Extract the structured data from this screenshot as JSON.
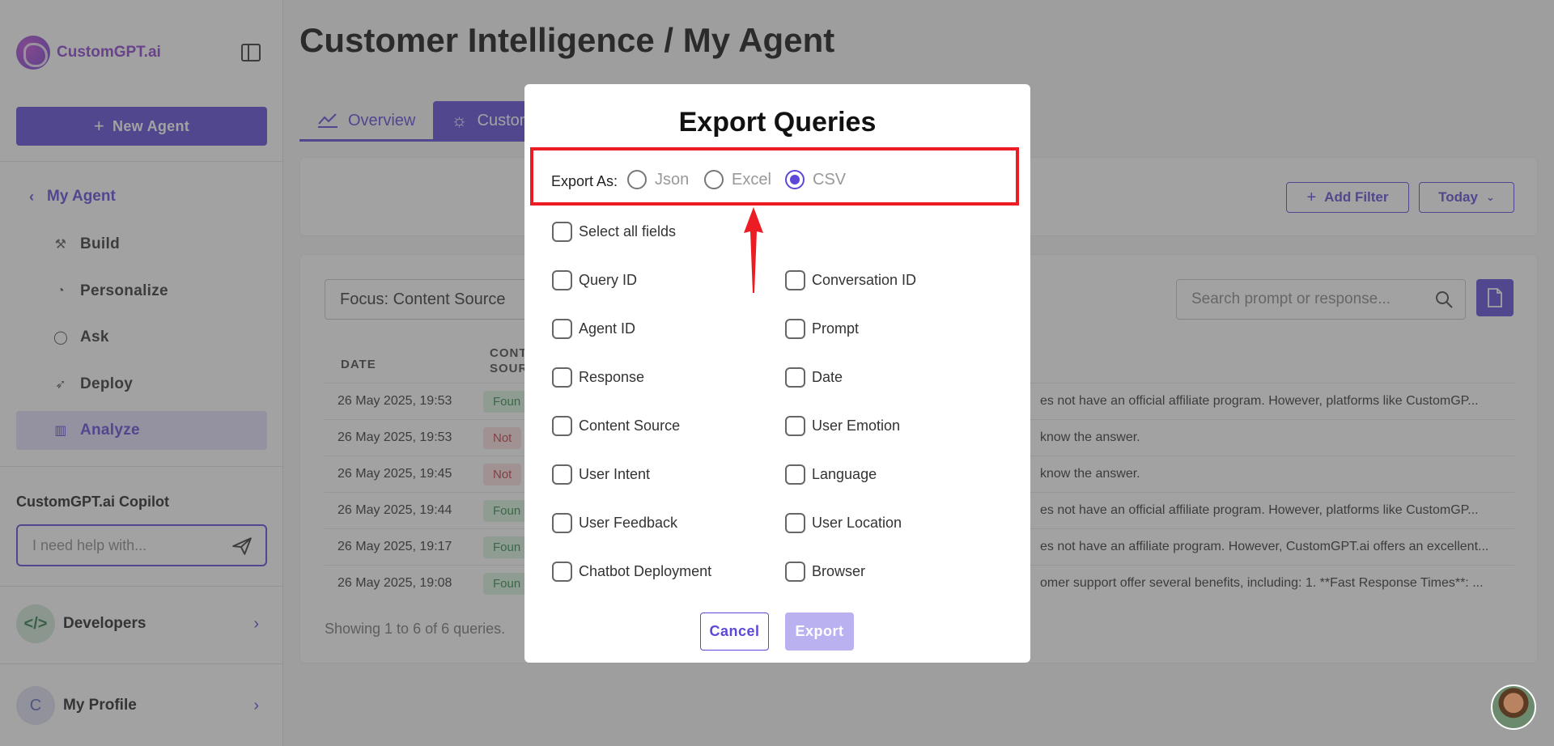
{
  "sidebar": {
    "logo_text": "CustomGPT.ai",
    "new_agent_label": "New Agent",
    "back_label": "My Agent",
    "items": [
      {
        "label": "Build",
        "icon": "build-icon"
      },
      {
        "label": "Personalize",
        "icon": "palette-icon"
      },
      {
        "label": "Ask",
        "icon": "chat-icon"
      },
      {
        "label": "Deploy",
        "icon": "rocket-icon"
      },
      {
        "label": "Analyze",
        "icon": "chart-icon",
        "active": true
      }
    ],
    "copilot_title": "CustomGPT.ai Copilot",
    "copilot_placeholder": "I need help with...",
    "developers_label": "Developers",
    "profile_label": "My Profile",
    "profile_initial": "C"
  },
  "header": {
    "title": "Customer Intelligence / My Agent"
  },
  "tabs": [
    {
      "label": "Overview",
      "icon": "line-chart-icon"
    },
    {
      "label": "Custom",
      "icon": "lightbulb-icon",
      "active": true
    }
  ],
  "filters": {
    "add_filter_label": "Add Filter",
    "date_range_label": "Today"
  },
  "table": {
    "focus_label": "Focus: Content Source",
    "search_placeholder": "Search prompt or response...",
    "columns": [
      "DATE",
      "CONT",
      "SOUR"
    ],
    "rows": [
      {
        "date": "26 May 2025, 19:53",
        "badge": "Foun",
        "status": "found",
        "response": "es not have an official affiliate program. However, platforms like CustomGP..."
      },
      {
        "date": "26 May 2025, 19:53",
        "badge": "Not",
        "status": "notfound",
        "response": "know the answer."
      },
      {
        "date": "26 May 2025, 19:45",
        "badge": "Not",
        "status": "notfound",
        "response": "know the answer."
      },
      {
        "date": "26 May 2025, 19:44",
        "badge": "Foun",
        "status": "found",
        "response": "es not have an official affiliate program. However, platforms like CustomGP..."
      },
      {
        "date": "26 May 2025, 19:17",
        "badge": "Foun",
        "status": "found",
        "response": "es not have an affiliate program. However, CustomGPT.ai offers an excellent..."
      },
      {
        "date": "26 May 2025, 19:08",
        "badge": "Foun",
        "status": "found",
        "response": "omer support offer several benefits, including: 1. **Fast Response Times**: ..."
      }
    ],
    "showing_text": "Showing 1 to 6 of 6 queries."
  },
  "modal": {
    "title": "Export Queries",
    "export_as_label": "Export As:",
    "formats": [
      {
        "label": "Json",
        "checked": false
      },
      {
        "label": "Excel",
        "checked": false
      },
      {
        "label": "CSV",
        "checked": true
      }
    ],
    "select_all_label": "Select all fields",
    "fields_left": [
      "Query ID",
      "Agent ID",
      "Response",
      "Content Source",
      "User Intent",
      "User Feedback",
      "Chatbot Deployment"
    ],
    "fields_right": [
      "Conversation ID",
      "Prompt",
      "Date",
      "User Emotion",
      "Language",
      "User Location",
      "Browser"
    ],
    "cancel_label": "Cancel",
    "export_label": "Export"
  },
  "colors": {
    "accent": "#5b48d8",
    "highlight_border": "#ec1c24",
    "found_badge": "#d9f2df",
    "notfound_badge": "#fbdede"
  }
}
